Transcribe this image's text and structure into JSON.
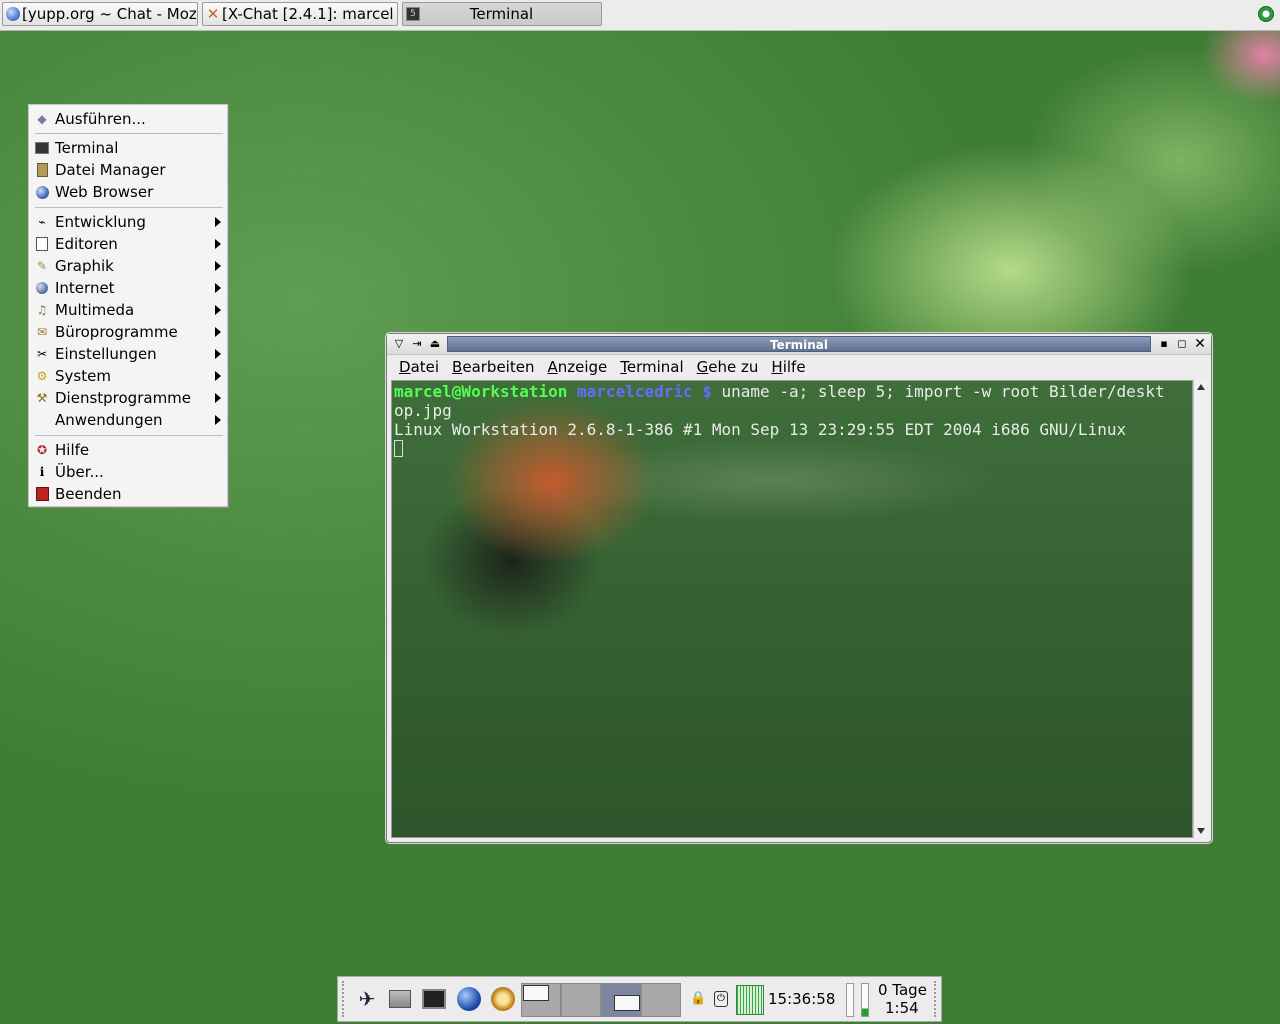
{
  "taskbar": {
    "tasks": [
      {
        "label": "[yupp.org ~ Chat - Moz",
        "icon": "globe-icon"
      },
      {
        "label": "[X-Chat [2.4.1]: marcel",
        "icon": "xchat-icon"
      },
      {
        "label": "Terminal",
        "icon": "terminal-icon"
      }
    ]
  },
  "menu": {
    "items": [
      {
        "label": "Ausführen...",
        "icon": "run-icon"
      },
      {
        "label": "Terminal",
        "icon": "terminal-icon"
      },
      {
        "label": "Datei Manager",
        "icon": "file-manager-icon"
      },
      {
        "label": "Web Browser",
        "icon": "web-browser-icon"
      },
      {
        "label": "Entwicklung",
        "icon": "development-icon",
        "submenu": true
      },
      {
        "label": "Editoren",
        "icon": "editor-icon",
        "submenu": true
      },
      {
        "label": "Graphik",
        "icon": "graphics-icon",
        "submenu": true
      },
      {
        "label": "Internet",
        "icon": "internet-icon",
        "submenu": true
      },
      {
        "label": "Multimeda",
        "icon": "multimedia-icon",
        "submenu": true
      },
      {
        "label": "Büroprogramme",
        "icon": "office-icon",
        "submenu": true
      },
      {
        "label": "Einstellungen",
        "icon": "settings-icon",
        "submenu": true
      },
      {
        "label": "System",
        "icon": "system-icon",
        "submenu": true
      },
      {
        "label": "Dienstprogramme",
        "icon": "utilities-icon",
        "submenu": true
      },
      {
        "label": "Anwendungen",
        "icon": "applications-icon",
        "submenu": true
      },
      {
        "label": "Hilfe",
        "icon": "help-icon"
      },
      {
        "label": "Über...",
        "icon": "info-icon"
      },
      {
        "label": "Beenden",
        "icon": "quit-icon"
      }
    ]
  },
  "terminal": {
    "title": "Terminal",
    "menus": [
      "Datei",
      "Bearbeiten",
      "Anzeige",
      "Terminal",
      "Gehe zu",
      "Hilfe"
    ],
    "prompt_user": "marcel@Workstation",
    "prompt_dir": "marcelcedric $",
    "command_part1": " uname -a; sleep 5; import -w root Bilder/deskt",
    "command_part2": "op.jpg",
    "output": "Linux Workstation 2.6.8-1-386 #1 Mon Sep 13 23:29:55 EDT 2004 i686 GNU/Linux"
  },
  "panel": {
    "clock": "15:36:58",
    "uptime_days": "0 Tage",
    "uptime_time": "1:54"
  }
}
